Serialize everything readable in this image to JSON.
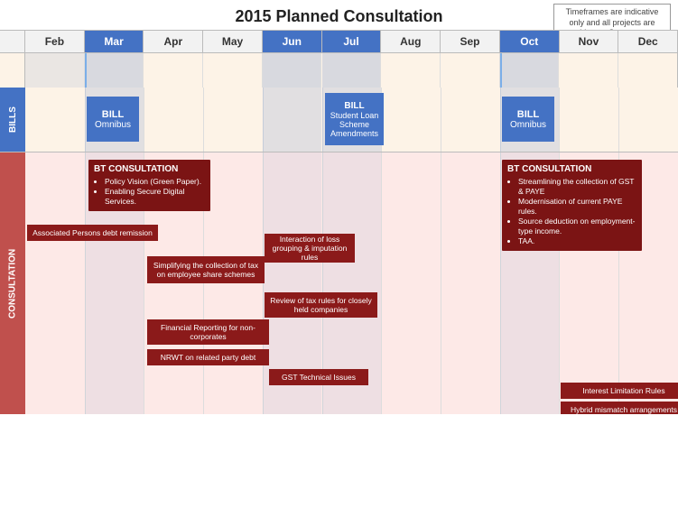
{
  "title": "2015 Planned Consultation",
  "note": "Timeframes are indicative only and all projects are subject to Government approval.",
  "months": [
    {
      "label": "Feb",
      "highlight": false
    },
    {
      "label": "Mar",
      "highlight": true
    },
    {
      "label": "Apr",
      "highlight": false
    },
    {
      "label": "May",
      "highlight": false
    },
    {
      "label": "Jun",
      "highlight": true
    },
    {
      "label": "Jul",
      "highlight": true
    },
    {
      "label": "Aug",
      "highlight": false
    },
    {
      "label": "Sep",
      "highlight": false
    },
    {
      "label": "Oct",
      "highlight": true
    },
    {
      "label": "Nov",
      "highlight": false
    },
    {
      "label": "Dec",
      "highlight": false
    }
  ],
  "labels": {
    "bills": "BILLS",
    "consultation": "CONSULTATION"
  },
  "bills": [
    {
      "title": "BILL",
      "subtitle": "Omnibus",
      "col_start": 1,
      "col_end": 2
    },
    {
      "title": "BILL",
      "subtitle": "Student Loan Scheme Amendments",
      "col_start": 5,
      "col_end": 6
    },
    {
      "title": "BILL",
      "subtitle": "Omnibus",
      "col_start": 9,
      "col_end": 10
    }
  ],
  "consultations": {
    "bt_consult_left": {
      "title": "BT CONSULTATION",
      "bullets": [
        "Policy Vision (Green Paper).",
        "Enabling Secure Digital Services."
      ]
    },
    "bt_consult_right": {
      "title": "BT CONSULTATION",
      "bullets": [
        "Streamlining the collection of GST & PAYE",
        "Modernisation of current PAYE rules.",
        "Source deduction on employment-type income.",
        "TAA."
      ]
    }
  },
  "bars": [
    {
      "label": "Associated Persons debt remission"
    },
    {
      "label": "Interaction of loss grouping & imputation rules"
    },
    {
      "label": "Simplifying the collection of tax on employee share schemes"
    },
    {
      "label": "Review of tax rules for closely held companies"
    },
    {
      "label": "Financial Reporting for non-corporates"
    },
    {
      "label": "NRWT on related party debt"
    },
    {
      "label": "GST Technical Issues"
    },
    {
      "label": "Interest Limitation Rules"
    },
    {
      "label": "Hybrid mismatch arrangements"
    }
  ]
}
